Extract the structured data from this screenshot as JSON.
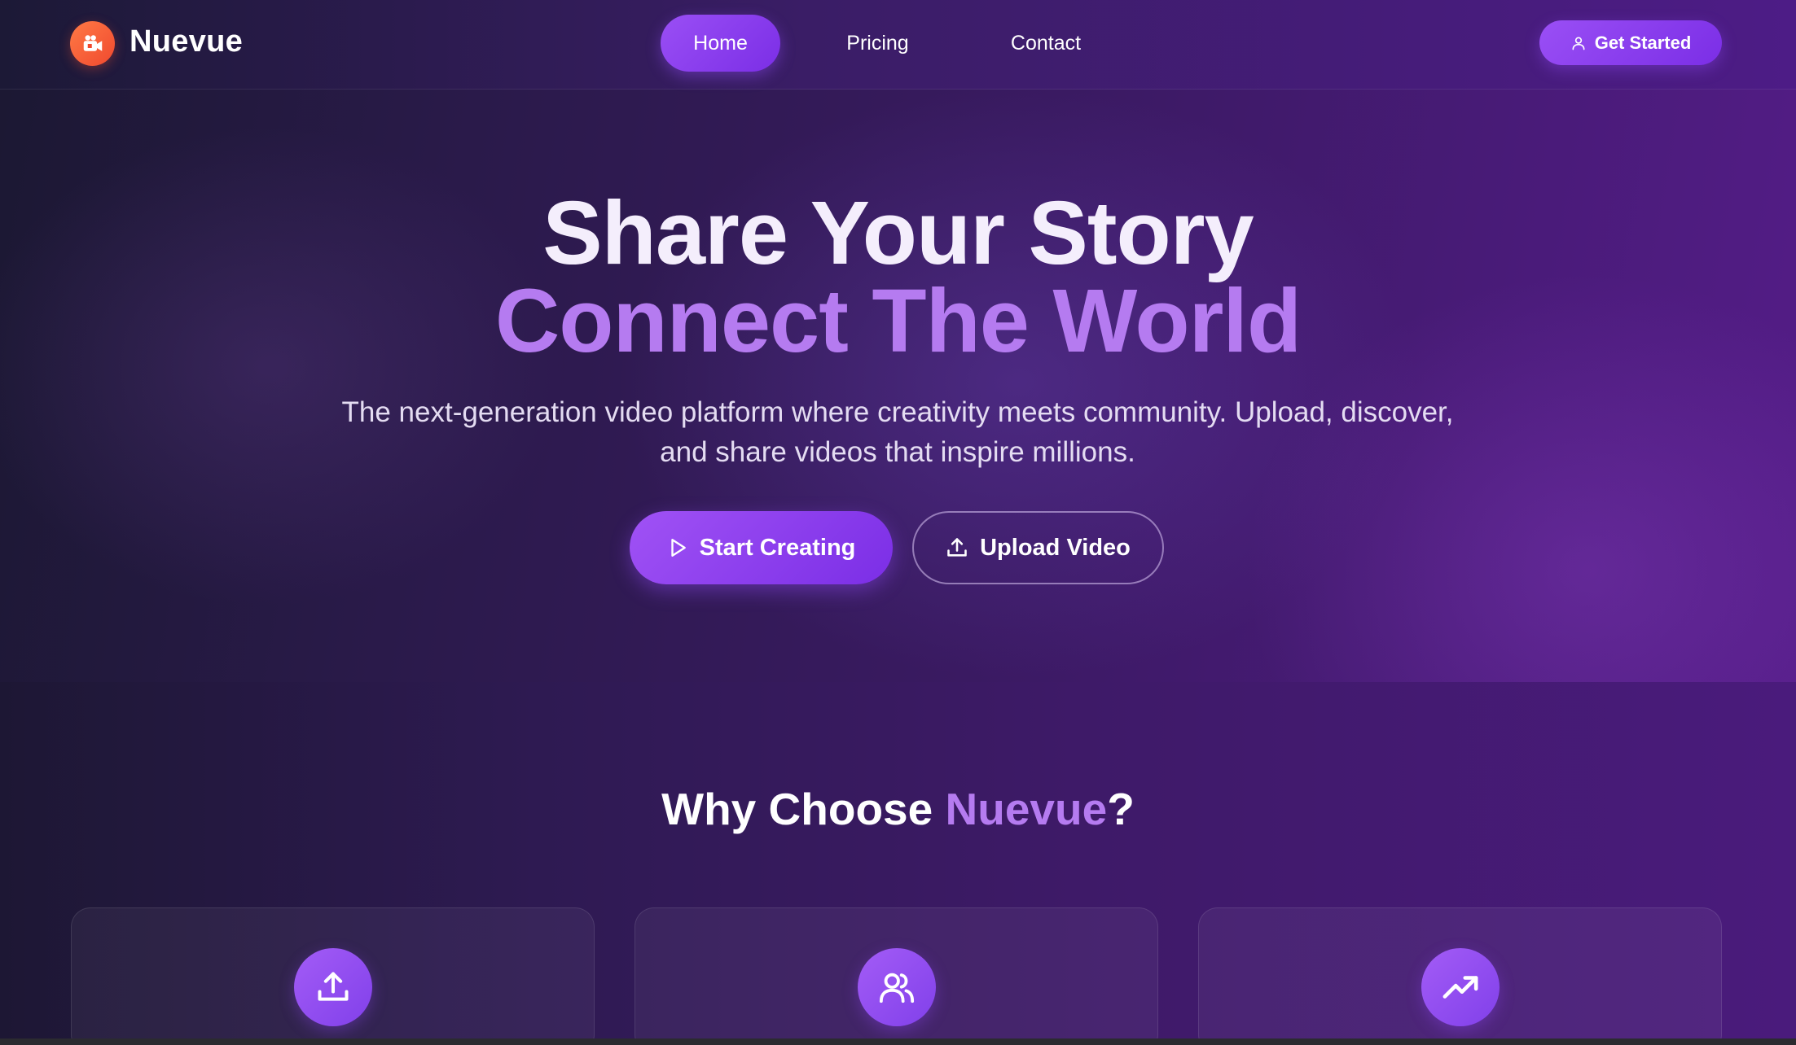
{
  "brand": {
    "name": "Nuevue",
    "logo_icon": "video-camera-icon"
  },
  "nav": {
    "links": [
      {
        "label": "Home",
        "active": true
      },
      {
        "label": "Pricing",
        "active": false
      },
      {
        "label": "Contact",
        "active": false
      }
    ],
    "cta": {
      "label": "Get Started",
      "icon": "user-icon"
    }
  },
  "hero": {
    "title_line1": "Share Your Story",
    "title_line2": "Connect The World",
    "subtitle": "The next-generation video platform where creativity meets community. Upload, discover, and share videos that inspire millions.",
    "primary_button": {
      "label": "Start Creating",
      "icon": "play-icon"
    },
    "secondary_button": {
      "label": "Upload Video",
      "icon": "upload-icon"
    }
  },
  "features": {
    "title_prefix": "Why Choose ",
    "title_accent": "Nuevue",
    "title_suffix": "?",
    "cards": [
      {
        "icon": "upload-icon"
      },
      {
        "icon": "users-icon"
      },
      {
        "icon": "trending-up-icon"
      }
    ]
  },
  "colors": {
    "accent": "#9a4ff5",
    "accent_text": "#b57bf0",
    "logo": "#f0492f"
  }
}
